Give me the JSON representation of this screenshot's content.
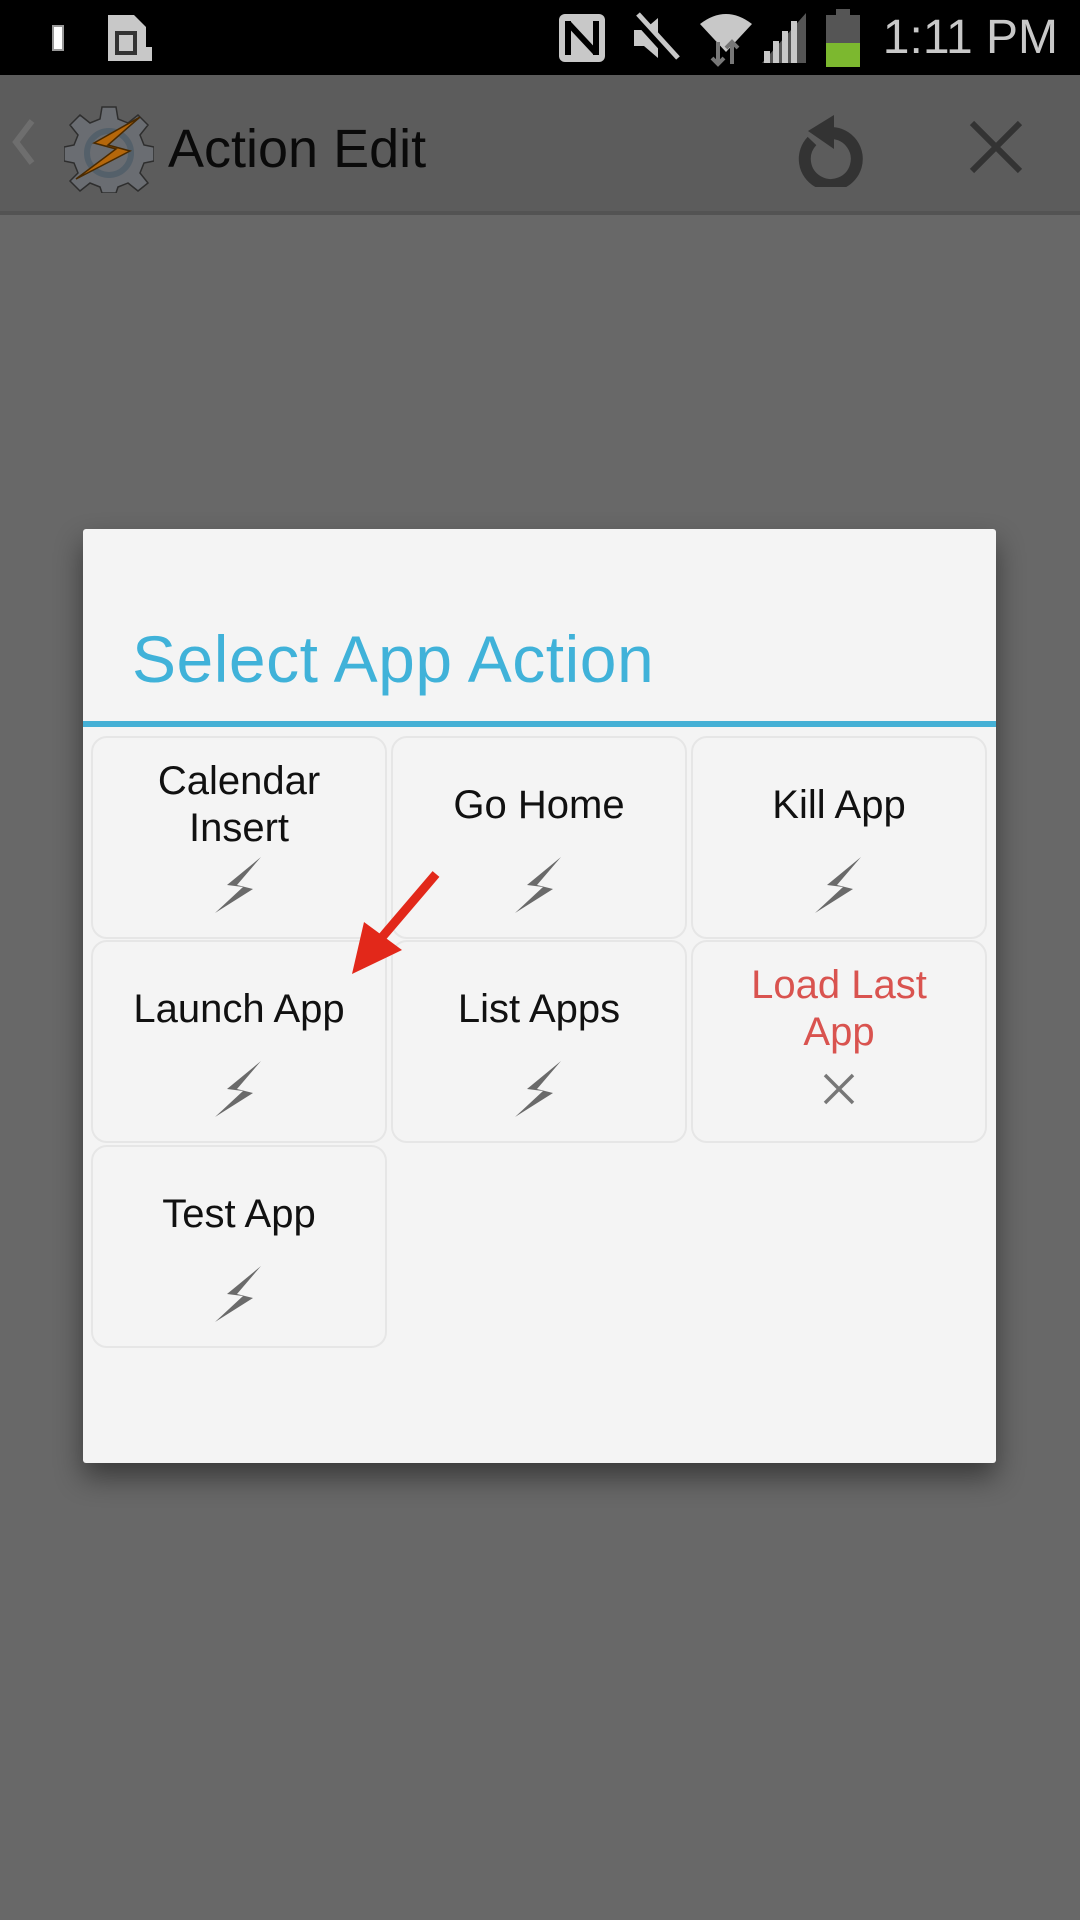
{
  "status_bar": {
    "time": "1:11 PM",
    "icons": [
      "notification-icon",
      "sim-card-icon",
      "nfc-icon",
      "mute-icon",
      "wifi-icon",
      "signal-icon",
      "battery-icon"
    ],
    "battery_level_percent": 40,
    "battery_color": "#7cb82f"
  },
  "action_bar": {
    "back_icon": "chevron-left-icon",
    "app_icon": "tasker-gear-bolt-icon",
    "title": "Action Edit",
    "actions": [
      {
        "name": "revert-icon"
      },
      {
        "name": "close-icon"
      }
    ]
  },
  "dialog": {
    "title": "Select App Action",
    "accent_color": "#40b2d9",
    "items": [
      {
        "label": "Calendar Insert",
        "icon": "bolt-icon",
        "state": "normal"
      },
      {
        "label": "Go Home",
        "icon": "bolt-icon",
        "state": "normal"
      },
      {
        "label": "Kill App",
        "icon": "bolt-icon",
        "state": "normal"
      },
      {
        "label": "Launch App",
        "icon": "bolt-icon",
        "state": "normal"
      },
      {
        "label": "List Apps",
        "icon": "bolt-icon",
        "state": "normal"
      },
      {
        "label": "Load Last App",
        "icon": "x-icon",
        "state": "unavailable"
      },
      {
        "label": "Test App",
        "icon": "bolt-icon",
        "state": "normal"
      }
    ]
  },
  "annotation": {
    "type": "arrow",
    "color": "#e2281a",
    "points_to": "Launch App"
  }
}
